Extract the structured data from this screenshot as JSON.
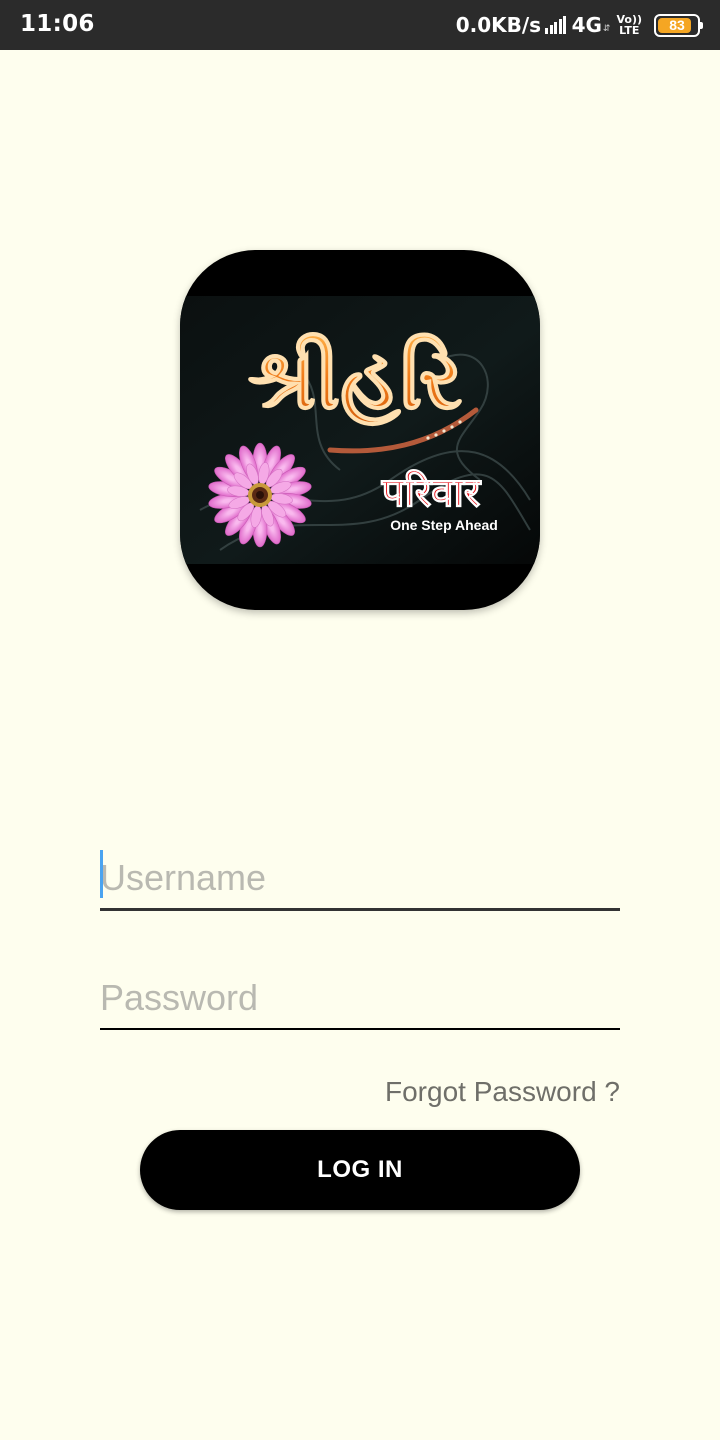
{
  "status_bar": {
    "time": "11:06",
    "net_speed": "0.0KB/s",
    "network_type": "4G",
    "volte_top": "Vo))",
    "volte_bottom": "LTE",
    "battery_level": "83",
    "icons": [
      "signal-icon",
      "data-arrows-icon",
      "volte-icon",
      "battery-icon"
    ]
  },
  "logo": {
    "title_gujarati": "શ્રીહરિ",
    "subtitle_hindi": "परिवार",
    "tagline": "One Step Ahead",
    "colors": {
      "background": "#000000",
      "title": "#f07a18",
      "subtitle": "#e8141c",
      "flower": "#e97fd6"
    }
  },
  "form": {
    "username_placeholder": "Username",
    "password_placeholder": "Password",
    "forgot_password": "Forgot Password ?",
    "login_button": "LOG IN"
  },
  "colors": {
    "page_background": "#fefeee",
    "status_bar": "#2b2b2b",
    "accent_cursor": "#4aa3f0",
    "battery": "#f5a623"
  }
}
